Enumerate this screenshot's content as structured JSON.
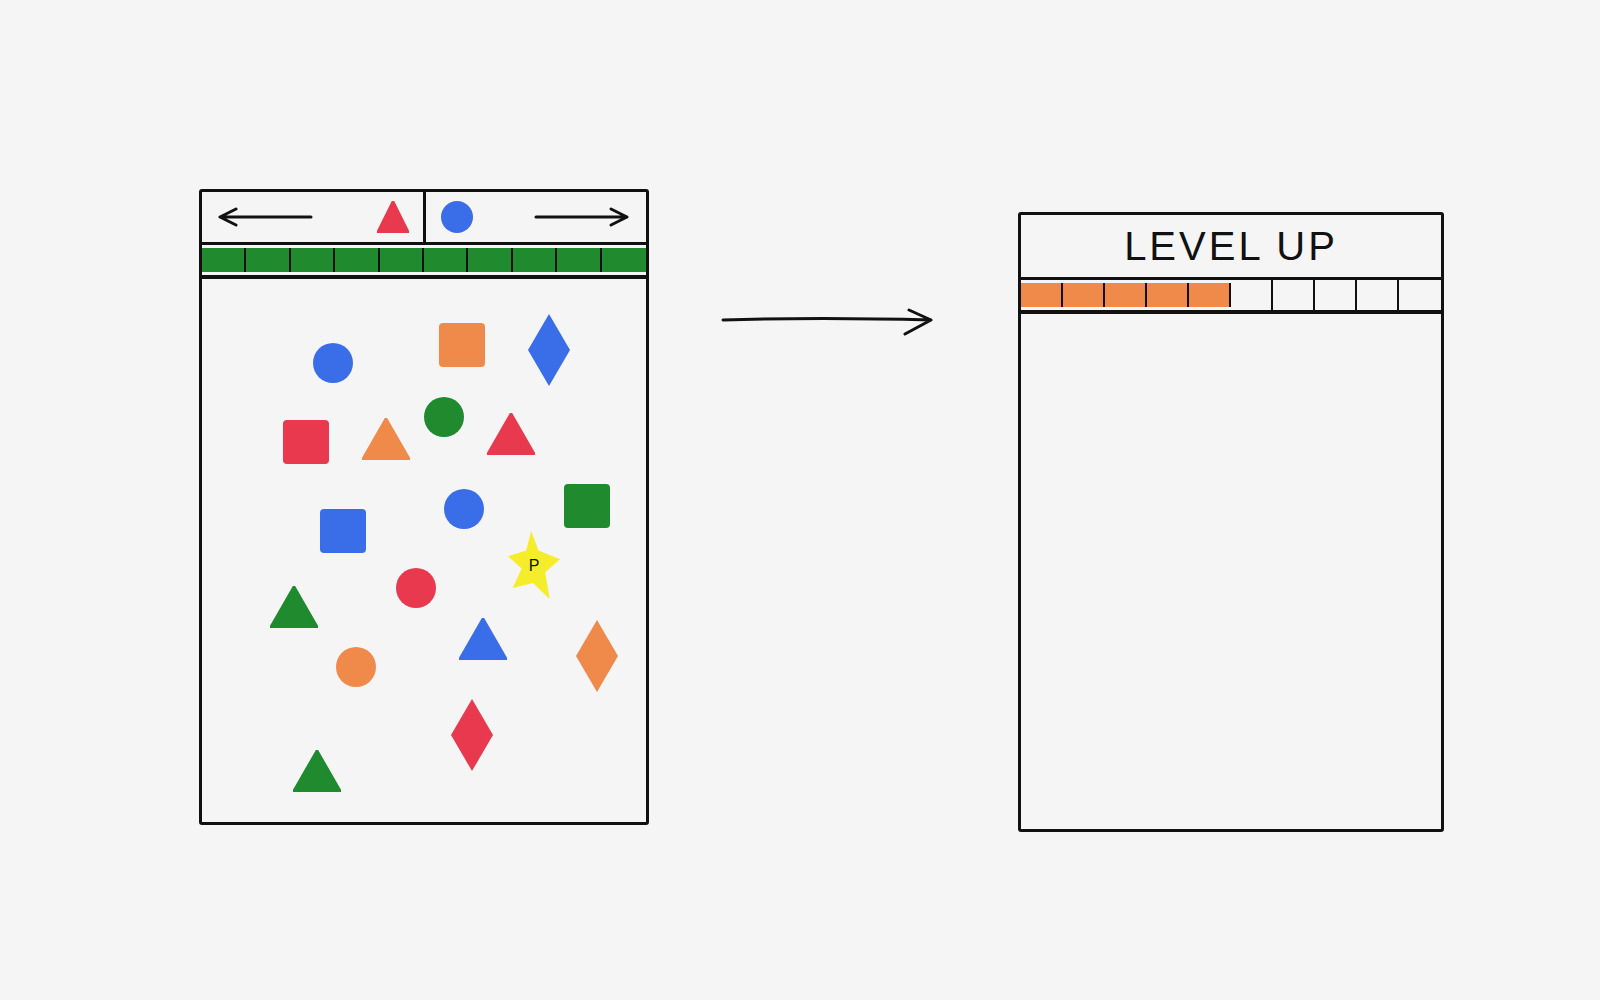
{
  "game_screen": {
    "header": {
      "targets": [
        {
          "kind": "triangle",
          "color": "#e8394e"
        },
        {
          "kind": "circle",
          "color": "#3a6ee8"
        }
      ]
    },
    "progress": {
      "segments": 10,
      "level": 1,
      "color": "#1f8a2e"
    },
    "pieces": [
      {
        "kind": "circle",
        "color": "#3a6ee8"
      },
      {
        "kind": "square",
        "color": "#f08a4b"
      },
      {
        "kind": "diamond",
        "color": "#3a6ee8"
      },
      {
        "kind": "square",
        "color": "#e8394e"
      },
      {
        "kind": "triangle",
        "color": "#f08a4b"
      },
      {
        "kind": "circle",
        "color": "#1f8a2e"
      },
      {
        "kind": "triangle",
        "color": "#e8394e"
      },
      {
        "kind": "square",
        "color": "#3a6ee8"
      },
      {
        "kind": "circle",
        "color": "#3a6ee8"
      },
      {
        "kind": "square",
        "color": "#1f8a2e"
      },
      {
        "kind": "star",
        "color": "#f5ec2a",
        "label": "P"
      },
      {
        "kind": "circle",
        "color": "#e8394e"
      },
      {
        "kind": "triangle",
        "color": "#1f8a2e"
      },
      {
        "kind": "circle",
        "color": "#f08a4b"
      },
      {
        "kind": "triangle",
        "color": "#3a6ee8"
      },
      {
        "kind": "diamond",
        "color": "#f08a4b"
      },
      {
        "kind": "diamond",
        "color": "#e8394e"
      },
      {
        "kind": "triangle",
        "color": "#1f8a2e"
      }
    ]
  },
  "level_up_screen": {
    "title": "LEVEL UP",
    "progress": {
      "segments": 10,
      "level": 0.5,
      "color": "#f08a4b"
    }
  }
}
